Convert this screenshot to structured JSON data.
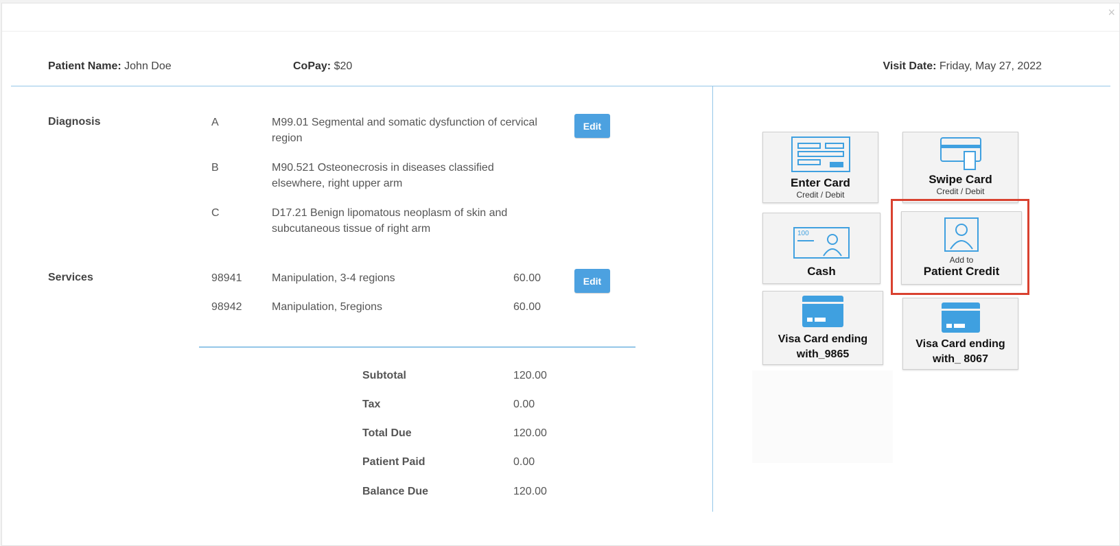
{
  "header": {
    "patient_name_label": "Patient Name:",
    "patient_name": "John Doe",
    "copay_label": "CoPay:",
    "copay": "$20",
    "visit_date_label": "Visit Date:",
    "visit_date": "Friday, May 27, 2022",
    "close_symbol": "×"
  },
  "diagnosis": {
    "label": "Diagnosis",
    "edit_label": "Edit",
    "items": [
      {
        "letter": "A",
        "text": "M99.01  Segmental and somatic dysfunction of cervical region"
      },
      {
        "letter": "B",
        "text": "M90.521  Osteonecrosis in diseases classified elsewhere, right upper arm"
      },
      {
        "letter": "C",
        "text": "D17.21  Benign lipomatous neoplasm of skin and subcutaneous tissue of right arm"
      }
    ]
  },
  "services": {
    "label": "Services",
    "edit_label": "Edit",
    "items": [
      {
        "code": "98941",
        "desc": "Manipulation, 3-4 regions",
        "amount": "60.00"
      },
      {
        "code": "98942",
        "desc": "Manipulation, 5regions",
        "amount": "60.00"
      }
    ]
  },
  "summary": [
    {
      "label": "Subtotal",
      "value": "120.00"
    },
    {
      "label": "Tax",
      "value": "0.00"
    },
    {
      "label": "Total Due",
      "value": "120.00"
    },
    {
      "label": "Patient Paid",
      "value": "0.00"
    },
    {
      "label": "Balance Due",
      "value": "120.00"
    }
  ],
  "payment": {
    "enter_card": {
      "title": "Enter Card",
      "sub": "Credit / Debit"
    },
    "swipe_card": {
      "title": "Swipe Card",
      "sub": "Credit / Debit"
    },
    "cash": {
      "title": "Cash",
      "note_value": "100"
    },
    "patient_credit": {
      "pre": "Add to",
      "title": "Patient Credit"
    },
    "visa_1": {
      "line1": "Visa Card ending",
      "line2": "with_9865"
    },
    "visa_2": {
      "line1": "Visa Card ending",
      "line2": "with_ 8067"
    }
  },
  "colors": {
    "accent": "#4ca1e0",
    "divider": "#93c6e8",
    "highlight": "#d9412f",
    "icon_blue": "#3fa0e0"
  }
}
